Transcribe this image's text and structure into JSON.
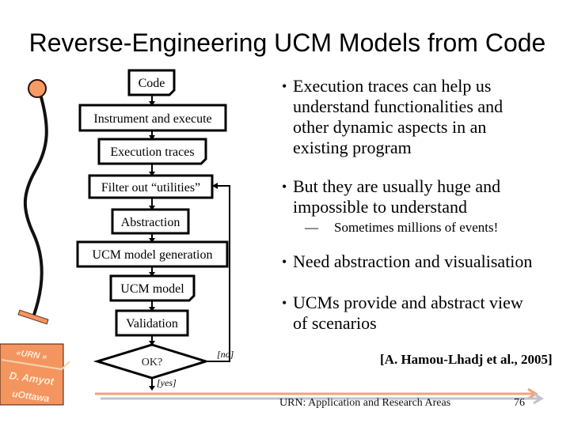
{
  "slide": {
    "title": "Reverse-Engineering UCM Models from Code",
    "footer_text": "URN: Application and Research Areas",
    "page_number": "76"
  },
  "ucm_path": {
    "start_icon": "start-point-filled-circle",
    "end_icon": "end-point-bar"
  },
  "flowchart": {
    "steps": [
      {
        "label": "Code",
        "shape": "document"
      },
      {
        "label": "Instrument and execute",
        "shape": "process"
      },
      {
        "label": "Execution traces",
        "shape": "document"
      },
      {
        "label": "Filter out “utilities”",
        "shape": "process"
      },
      {
        "label": "Abstraction",
        "shape": "process"
      },
      {
        "label": "UCM model generation",
        "shape": "process"
      },
      {
        "label": "UCM model",
        "shape": "document"
      },
      {
        "label": "Validation",
        "shape": "process"
      }
    ],
    "decision": {
      "label": "OK?",
      "no_label": "[no]",
      "yes_label": "[yes]",
      "no_target": "Filter out “utilities”"
    }
  },
  "bullet_glyph": "•",
  "bullets": [
    {
      "lines": [
        "Execution traces can help us",
        "understand functionalities and",
        "other dynamic aspects in an",
        "existing program"
      ]
    },
    {
      "lines": [
        "But they are usually huge and",
        "impossible to understand"
      ],
      "sub": [
        {
          "dash": "—",
          "text": "Sometimes millions of events!"
        }
      ]
    },
    {
      "lines": [
        "Need abstraction and visualisation"
      ]
    },
    {
      "lines": [
        "UCMs provide and abstract view",
        "of scenarios"
      ]
    }
  ],
  "citation": "[A. Hamou-Lhadj et al., 2005]",
  "logo": {
    "line1": "«URN »",
    "line2": "D. Amyot",
    "line3": "uOttawa"
  },
  "colors": {
    "accent_orange": "#F4955F",
    "footer_orange": "#F2A27C",
    "footer_gray": "#C2C2CA",
    "text": "#000000"
  }
}
